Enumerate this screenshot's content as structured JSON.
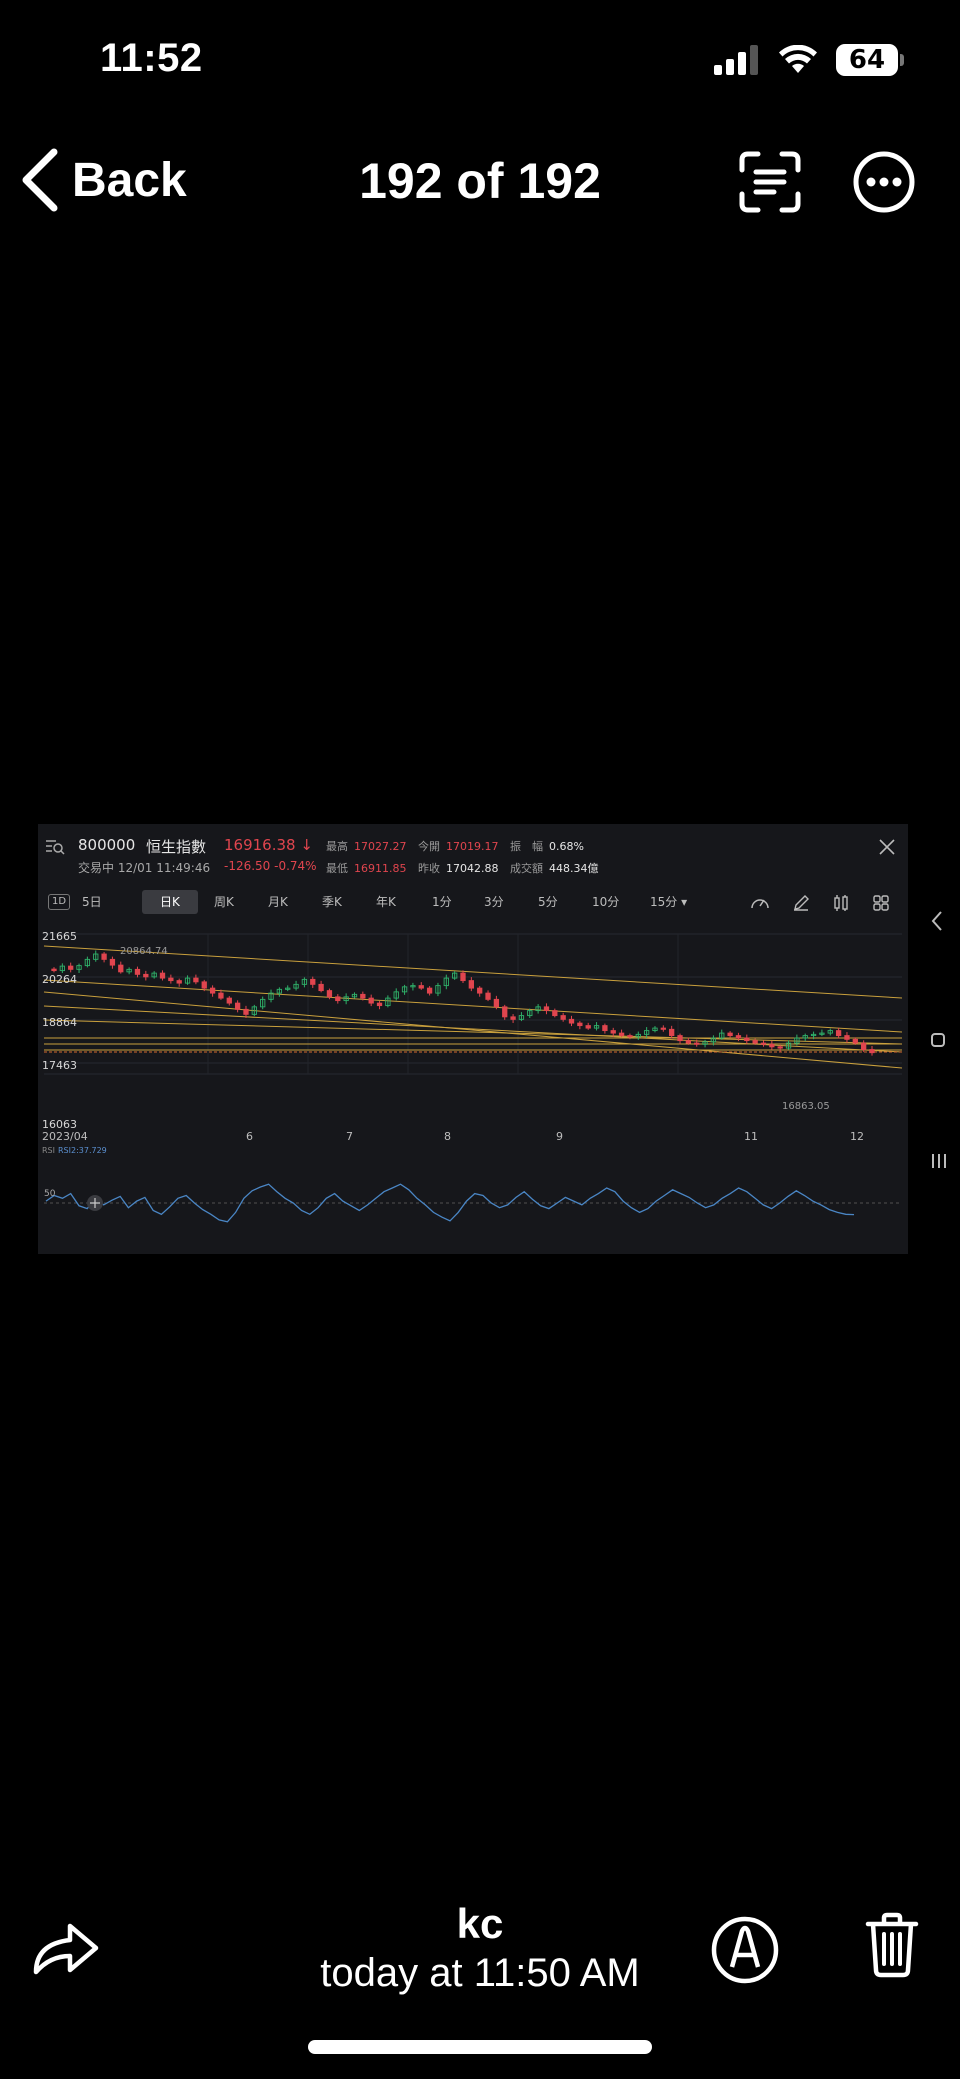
{
  "status_bar": {
    "time": "11:52",
    "battery": "64"
  },
  "nav": {
    "back_label": "Back",
    "title": "192 of 192"
  },
  "photo": {
    "header": {
      "code": "800000",
      "name": "恒生指數",
      "price": "16916.38",
      "status": "交易中 12/01 11:49:46",
      "change": "-126.50 -0.74%",
      "stats": [
        {
          "label": "最高",
          "value": "17027.27",
          "tone": "red"
        },
        {
          "label": "最低",
          "value": "16911.85",
          "tone": "red"
        },
        {
          "label": "今開",
          "value": "17019.17",
          "tone": "red"
        },
        {
          "label": "昨收",
          "value": "17042.88",
          "tone": "wht"
        },
        {
          "label": "振　幅",
          "value": "0.68%",
          "tone": "wht"
        },
        {
          "label": "成交額",
          "value": "448.34億",
          "tone": "wht"
        }
      ]
    },
    "tabs": [
      "1D",
      "5日",
      "日K",
      "周K",
      "月K",
      "季K",
      "年K",
      "1分",
      "3分",
      "5分",
      "10分",
      "15分 ▾"
    ],
    "active_tab": "日K",
    "chart_data": {
      "type": "candlestick",
      "y_ticks": [
        "21665",
        "20264",
        "18864",
        "17463",
        "16063"
      ],
      "ylim": [
        16063,
        21665
      ],
      "x_ticks": [
        "2023/04",
        "6",
        "7",
        "8",
        "9",
        "11",
        "12"
      ],
      "annotations": [
        {
          "text": "20864.74",
          "kind": "high"
        },
        {
          "text": "16863.05",
          "kind": "low"
        }
      ],
      "closes": [
        20200,
        20380,
        20250,
        20400,
        20650,
        20864,
        20650,
        20420,
        20150,
        20250,
        20050,
        19950,
        20100,
        19900,
        19800,
        19700,
        19900,
        19750,
        19500,
        19300,
        19100,
        18900,
        18650,
        18450,
        18750,
        19050,
        19300,
        19450,
        19500,
        19650,
        19850,
        19650,
        19400,
        19150,
        19000,
        19150,
        19250,
        19100,
        18900,
        18800,
        19100,
        19350,
        19550,
        19600,
        19500,
        19300,
        19600,
        19900,
        20100,
        19800,
        19500,
        19300,
        19050,
        18750,
        18350,
        18250,
        18400,
        18600,
        18750,
        18600,
        18400,
        18250,
        18100,
        18000,
        17900,
        18000,
        17800,
        17700,
        17600,
        17550,
        17650,
        17800,
        17900,
        17850,
        17600,
        17400,
        17300,
        17250,
        17350,
        17500,
        17700,
        17600,
        17500,
        17400,
        17300,
        17250,
        17150,
        17100,
        17300,
        17500,
        17600,
        17650,
        17700,
        17800,
        17600,
        17450,
        17300,
        17042,
        16916
      ],
      "rsi": {
        "label": "RSI",
        "series_name": "RSI2:37.729",
        "reference": "50",
        "values": [
          52,
          58,
          55,
          60,
          47,
          44,
          55,
          48,
          53,
          57,
          45,
          52,
          56,
          42,
          38,
          46,
          55,
          58,
          50,
          43,
          38,
          32,
          30,
          40,
          55,
          63,
          67,
          70,
          62,
          55,
          50,
          42,
          38,
          45,
          55,
          60,
          52,
          47,
          42,
          48,
          55,
          62,
          66,
          70,
          64,
          55,
          48,
          40,
          35,
          31,
          40,
          52,
          60,
          58,
          50,
          45,
          48,
          56,
          62,
          54,
          47,
          44,
          50,
          56,
          52,
          48,
          55,
          60,
          66,
          62,
          52,
          45,
          40,
          44,
          52,
          58,
          64,
          60,
          56,
          50,
          45,
          48,
          55,
          60,
          66,
          62,
          55,
          48,
          44,
          50,
          57,
          63,
          58,
          52,
          48,
          43,
          40,
          38,
          37.7
        ]
      }
    }
  },
  "footer": {
    "name": "kc",
    "time": "today at 11:50 AM"
  }
}
